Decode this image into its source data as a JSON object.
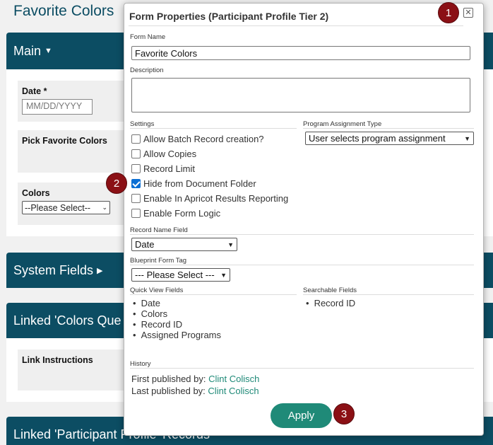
{
  "background": {
    "title": "Favorite Colors",
    "main_section": "Main",
    "date_label": "Date *",
    "date_placeholder": "MM/DD/YYYY",
    "pick_colors_label": "Pick Favorite Colors",
    "colors_label": "Colors",
    "colors_select": "--Please Select--",
    "system_fields": "System Fields",
    "linked_colors": "Linked 'Colors Que",
    "link_instructions": "Link Instructions",
    "linked_participant": "Linked 'Participant Profile' Records"
  },
  "modal": {
    "title": "Form Properties (Participant Profile Tier 2)",
    "form_name_label": "Form Name",
    "form_name_value": "Favorite Colors",
    "description_label": "Description",
    "settings_label": "Settings",
    "program_assignment_label": "Program Assignment Type",
    "program_assignment_value": "User selects program assignment",
    "settings": [
      {
        "label": "Allow Batch Record creation?",
        "checked": false
      },
      {
        "label": "Allow Copies",
        "checked": false
      },
      {
        "label": "Record Limit",
        "checked": false
      },
      {
        "label": "Hide from Document Folder",
        "checked": true
      },
      {
        "label": "Enable In Apricot Results Reporting",
        "checked": false
      },
      {
        "label": "Enable Form Logic",
        "checked": false
      }
    ],
    "record_name_label": "Record Name Field",
    "record_name_value": "Date",
    "blueprint_label": "Blueprint Form Tag",
    "blueprint_value": "--- Please Select ---",
    "quick_view_label": "Quick View Fields",
    "quick_view_fields": [
      "Date",
      "Colors",
      "Record ID",
      "Assigned Programs"
    ],
    "searchable_label": "Searchable Fields",
    "searchable_fields": [
      "Record ID"
    ],
    "history_label": "History",
    "first_published_label": "First published by:",
    "first_published_by": "Clint Colisch",
    "last_published_label": "Last published by:",
    "last_published_by": "Clint Colisch",
    "apply_label": "Apply"
  },
  "badges": [
    "1",
    "2",
    "3"
  ],
  "colors": {
    "brand": "#0c4d63",
    "accent": "#1f8a78",
    "badge": "#8b1015",
    "checkbox": "#0b6fd4"
  }
}
